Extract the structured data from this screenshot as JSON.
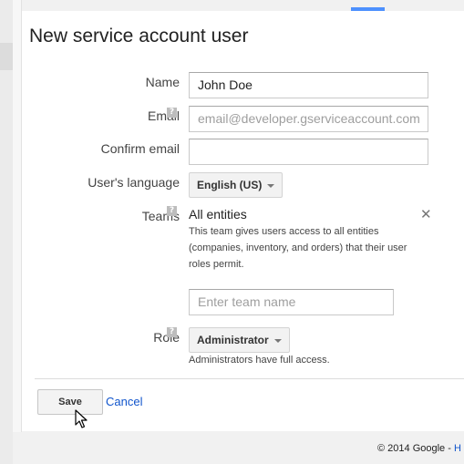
{
  "dialog": {
    "title": "New service account user"
  },
  "form": {
    "name": {
      "label": "Name",
      "value": "John Doe"
    },
    "email": {
      "label": "Email",
      "placeholder": "email@developer.gserviceaccount.com"
    },
    "confirm_email": {
      "label": "Confirm email",
      "value": ""
    },
    "language": {
      "label": "User's language",
      "selected": "English (US)"
    },
    "teams": {
      "label": "Teams",
      "entity": "All entities",
      "description": "This team gives users access to all entities (companies, inventory, and orders) that their user roles permit.",
      "team_input_placeholder": "Enter team name"
    },
    "role": {
      "label": "Role",
      "selected": "Administrator",
      "note": "Administrators have full access."
    }
  },
  "help_glyph": "?",
  "close_glyph": "✕",
  "actions": {
    "save": "Save",
    "cancel": "Cancel"
  },
  "footer": {
    "copyright": "© 2014 Google - ",
    "link": "H"
  },
  "colors": {
    "accent": "#4d90fe",
    "link": "#1155cc"
  }
}
